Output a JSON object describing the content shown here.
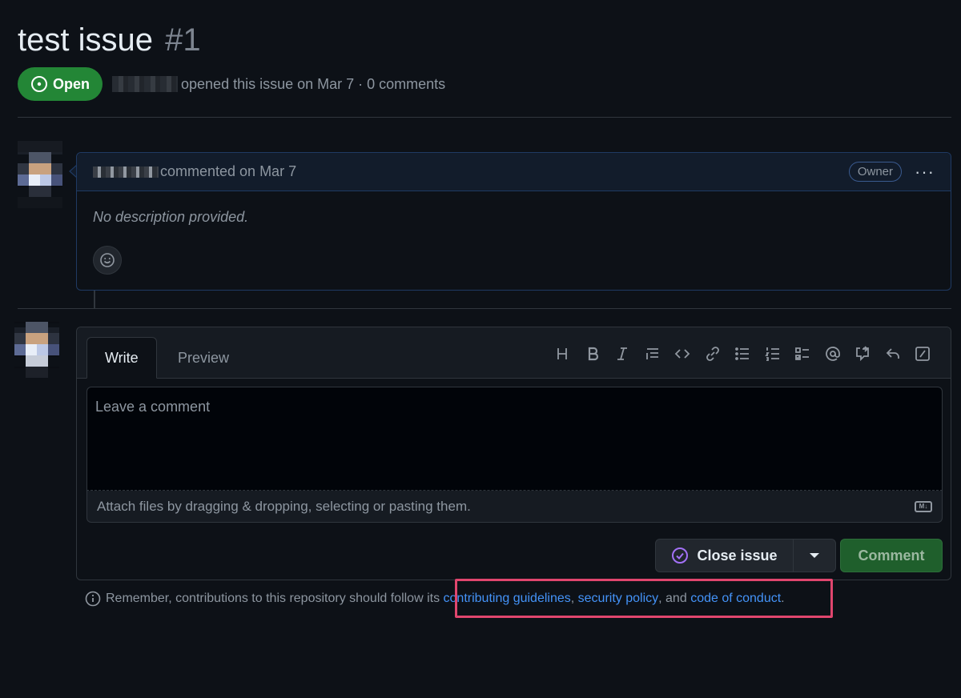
{
  "issue": {
    "title": "test issue",
    "number": "#1",
    "status": "Open",
    "status_color": "#238636",
    "meta": "opened this issue on Mar 7 · 0 comments"
  },
  "comment": {
    "author_action": "commented on Mar 7",
    "role_badge": "Owner",
    "body": "No description provided.",
    "menu_icon": "kebab-horizontal-icon",
    "reaction_icon": "smiley-icon"
  },
  "editor": {
    "tabs": [
      "Write",
      "Preview"
    ],
    "toolbar": [
      {
        "name": "heading-icon",
        "label": "H"
      },
      {
        "name": "bold-icon",
        "label": "B"
      },
      {
        "name": "italic-icon",
        "label": "I"
      },
      {
        "name": "quote-icon",
        "label": ""
      },
      {
        "name": "code-icon",
        "label": ""
      },
      {
        "name": "link-icon",
        "label": ""
      },
      {
        "name": "unordered-list-icon",
        "label": ""
      },
      {
        "name": "ordered-list-icon",
        "label": ""
      },
      {
        "name": "task-list-icon",
        "label": ""
      },
      {
        "name": "mention-icon",
        "label": "@"
      },
      {
        "name": "cross-reference-icon",
        "label": ""
      },
      {
        "name": "reply-icon",
        "label": ""
      },
      {
        "name": "slash-commands-icon",
        "label": ""
      }
    ],
    "placeholder": "Leave a comment",
    "attach_text": "Attach files by dragging & dropping, selecting or pasting them.",
    "markdown_icon": "markdown-icon"
  },
  "actions": {
    "close_issue": "Close issue",
    "comment": "Comment"
  },
  "footer": {
    "prefix": "Remember, contributions to this repository should follow its",
    "link1": "contributing guidelines",
    "sep1": ",",
    "link2": "security policy",
    "sep2": ", and",
    "link3": "code of conduct",
    "suffix": ".",
    "highlight_color": "#e0466e"
  }
}
